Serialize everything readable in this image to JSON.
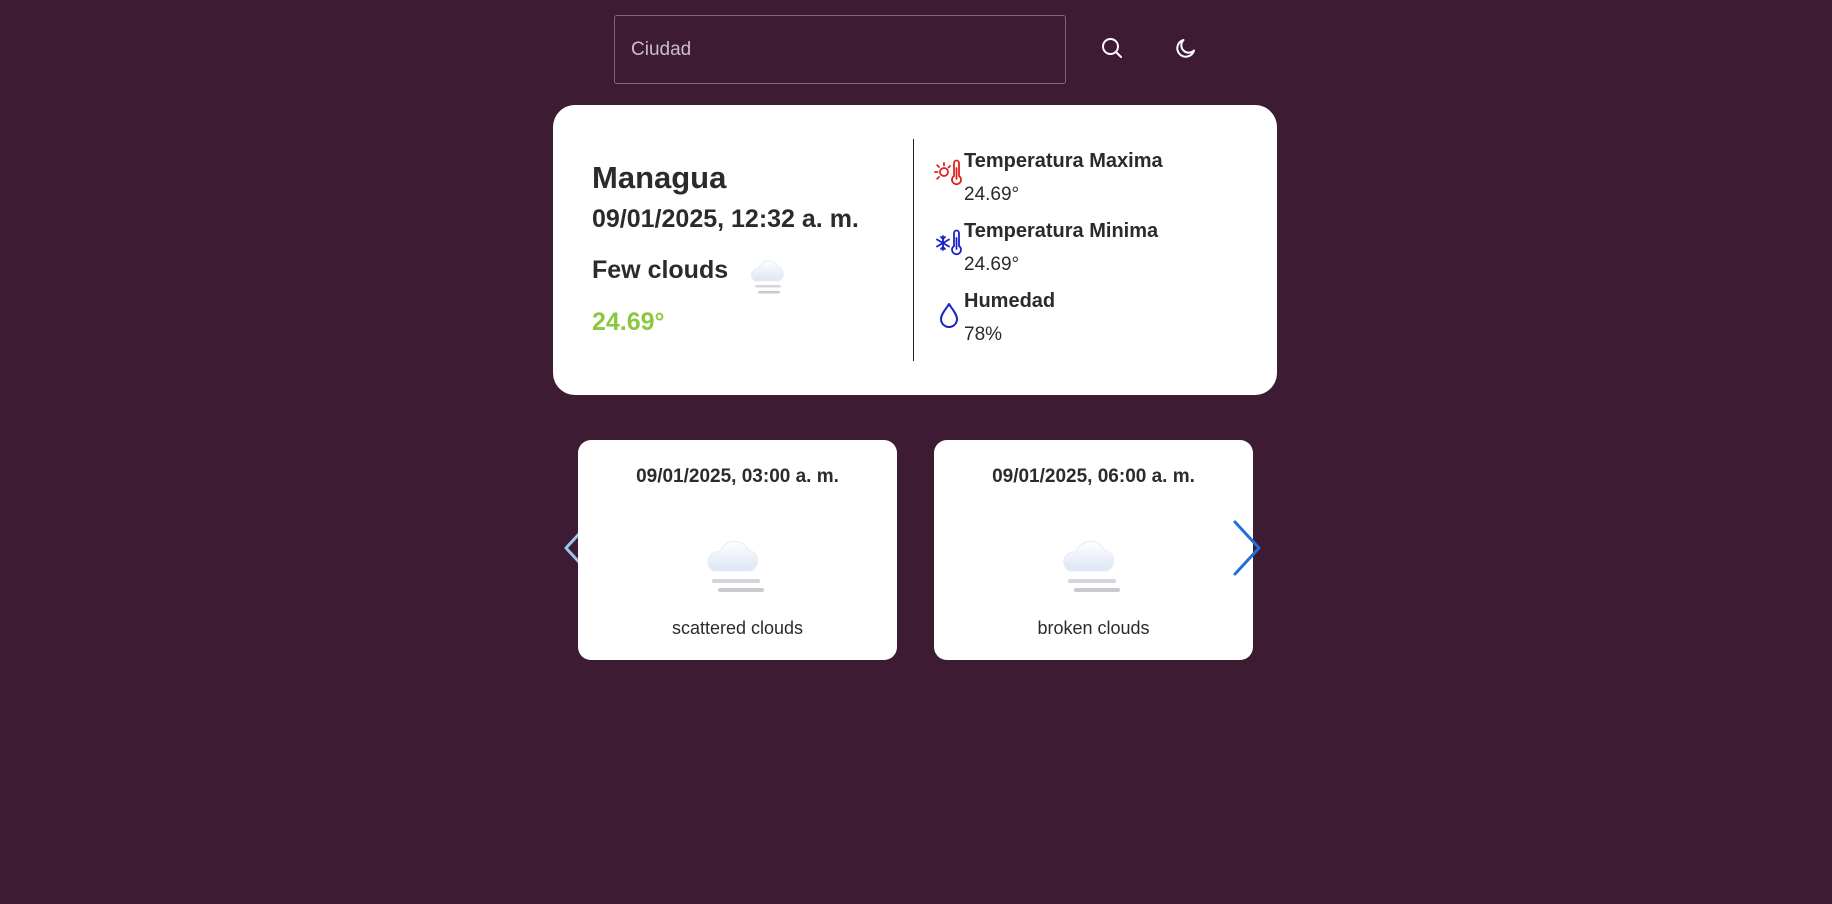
{
  "search": {
    "placeholder": "Ciudad",
    "value": ""
  },
  "icons": {
    "search": "search-icon",
    "theme": "moon-icon",
    "max_temp": "thermometer-sun-icon",
    "min_temp": "thermometer-snow-icon",
    "humidity": "droplet-icon",
    "weather": "cloud-icon",
    "prev": "chevron-left-icon",
    "next": "chevron-right-icon"
  },
  "colors": {
    "background": "#3c1b33",
    "temperature": "#8dc63f",
    "max_temp_icon": "#e02020",
    "min_temp_icon": "#1a22c8",
    "humidity_icon": "#1a22c8",
    "arrow_active": "#1e6fd9",
    "arrow_disabled": "#9cc4ef"
  },
  "current": {
    "city": "Managua",
    "datetime": "09/01/2025, 12:32 a. m.",
    "description": "Few clouds",
    "temperature": "24.69°"
  },
  "stats": [
    {
      "label": "Temperatura Maxima",
      "value": "24.69°"
    },
    {
      "label": "Temperatura Minima",
      "value": "24.69°"
    },
    {
      "label": "Humedad",
      "value": "78%"
    }
  ],
  "forecast": [
    {
      "datetime": "09/01/2025, 03:00 a. m.",
      "description": "scattered clouds"
    },
    {
      "datetime": "09/01/2025, 06:00 a. m.",
      "description": "broken clouds"
    }
  ]
}
